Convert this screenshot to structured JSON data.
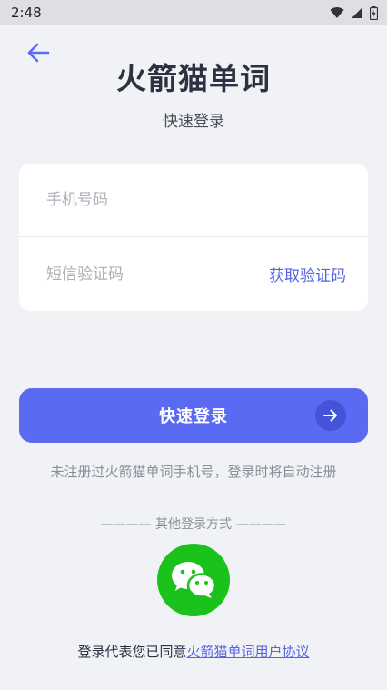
{
  "status_bar": {
    "time": "2:48",
    "icons": [
      "wifi-icon",
      "signal-icon",
      "battery-icon"
    ]
  },
  "header": {
    "back_icon": "arrow-left-icon",
    "title": "火箭猫单词",
    "subtitle": "快速登录"
  },
  "form": {
    "phone_placeholder": "手机号码",
    "phone_value": "",
    "code_placeholder": "短信验证码",
    "code_value": "",
    "get_code_label": "获取验证码"
  },
  "login_button": {
    "label": "快速登录",
    "icon": "arrow-right-icon"
  },
  "hint": "未注册过火箭猫单词手机号，登录时将自动注册",
  "other_login": {
    "label": "———— 其他登录方式 ————",
    "wechat_icon": "wechat-icon"
  },
  "agreement": {
    "prefix": "登录代表您已同意",
    "link": "火箭猫单词用户协议"
  },
  "colors": {
    "accent": "#5b6af2",
    "link": "#5563e0",
    "wechat": "#1bc21b",
    "background": "#f1f2f6"
  }
}
